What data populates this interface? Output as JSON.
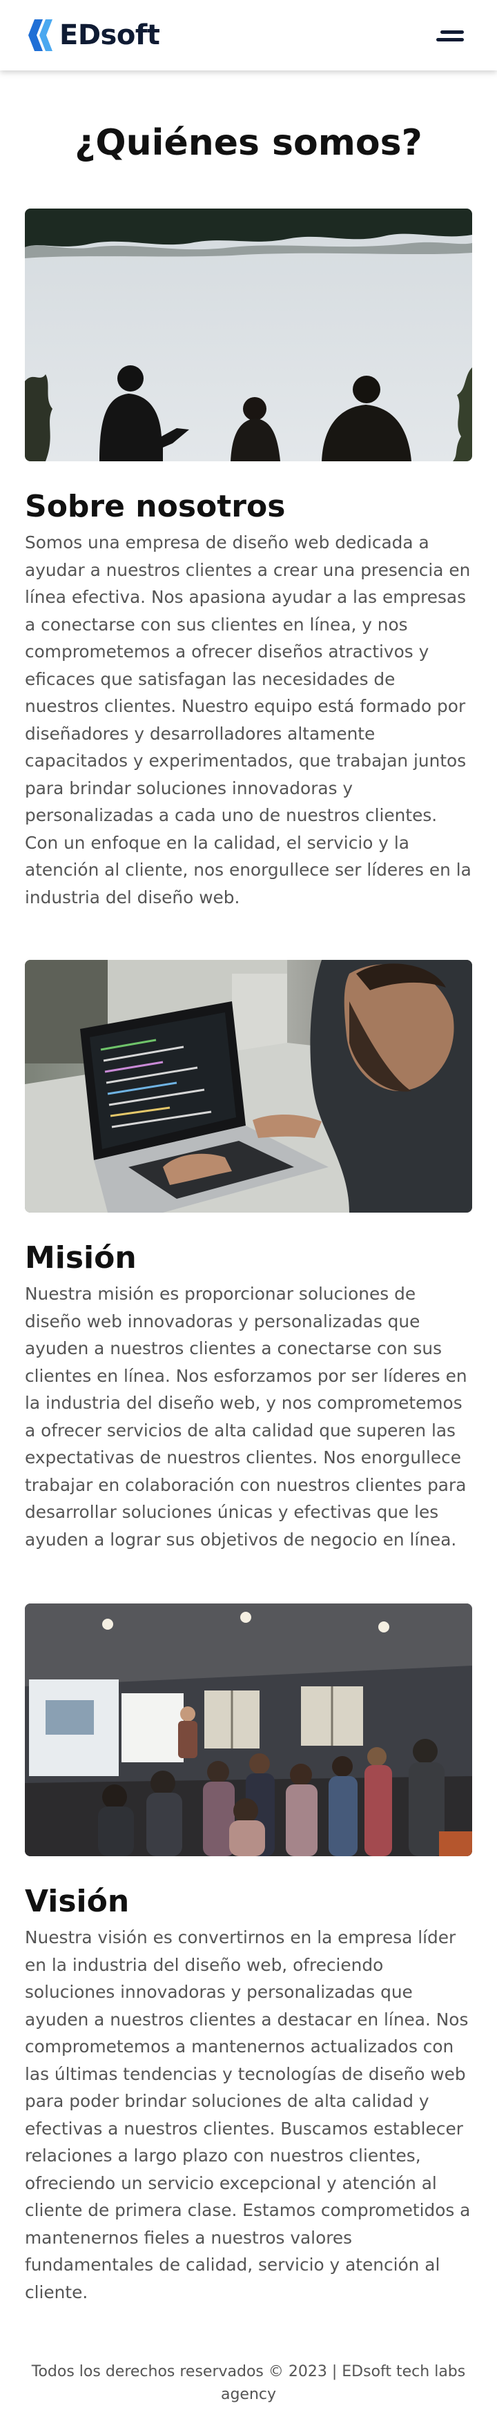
{
  "brand": {
    "name": "EDsoft",
    "accent": "#2f8fe5",
    "logo_icon": "bracket-logo-icon"
  },
  "header": {
    "menu_icon": "hamburger-menu-icon"
  },
  "page": {
    "title": "¿Quiénes somos?"
  },
  "sections": [
    {
      "image": "team-talking-outdoors-photo",
      "title": "Sobre nosotros",
      "text": "Somos una empresa de diseño web dedicada a ayudar a nuestros clientes a crear una presencia en línea efectiva. Nos apasiona ayudar a las empresas a conectarse con sus clientes en línea, y nos comprometemos a ofrecer diseños atractivos y eficaces que satisfagan las necesidades de nuestros clientes. Nuestro equipo está formado por diseñadores y desarrolladores altamente capacitados y experimentados, que trabajan juntos para brindar soluciones innovadoras y personalizadas a cada uno de nuestros clientes. Con un enfoque en la calidad, el servicio y la atención al cliente, nos enorgullece ser líderes en la industria del diseño web."
    },
    {
      "image": "developer-coding-laptop-photo",
      "title": "Misión",
      "text": "Nuestra misión es proporcionar soluciones de diseño web innovadoras y personalizadas que ayuden a nuestros clientes a conectarse con sus clientes en línea. Nos esforzamos por ser líderes en la industria del diseño web, y nos comprometemos a ofrecer servicios de alta calidad que superen las expectativas de nuestros clientes. Nos enorgullece trabajar en colaboración con nuestros clientes para desarrollar soluciones únicas y efectivas que les ayuden a lograr sus objetivos de negocio en línea."
    },
    {
      "image": "presentation-audience-photo",
      "title": "Visión",
      "text": "Nuestra visión es convertirnos en la empresa líder en la industria del diseño web, ofreciendo soluciones innovadoras y personalizadas que ayuden a nuestros clientes a destacar en línea. Nos comprometemos a mantenernos actualizados con las últimas tendencias y tecnologías de diseño web para poder brindar soluciones de alta calidad y efectivas a nuestros clientes. Buscamos establecer relaciones a largo plazo con nuestros clientes, ofreciendo un servicio excepcional y atención al cliente de primera clase. Estamos comprometidos a mantenernos fieles a nuestros valores fundamentales de calidad, servicio y atención al cliente."
    }
  ],
  "footer": {
    "text": "Todos los derechos reservados © 2023 | EDsoft tech labs agency"
  }
}
